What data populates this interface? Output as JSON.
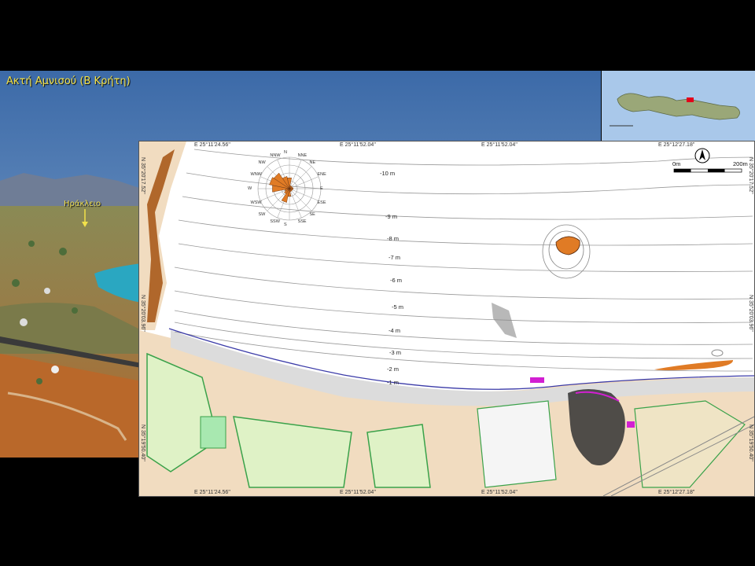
{
  "photo": {
    "title": "Ακτή Αμνισού (Β Κρήτη)",
    "city_label": "Ηράκλειο"
  },
  "map": {
    "coords_top": [
      "E 25°11'24.56\"",
      "E 25°11'52.04\"",
      "E 25°11'52.04\"",
      "E 25°12'27.18\""
    ],
    "coords_bottom": [
      "E 25°11'24.56\"",
      "E 25°11'52.04\"",
      "E 25°11'52.04\"",
      "E 25°12'27.18\""
    ],
    "coords_left": [
      "N 35°20'17.52\"",
      "N 35°20'03.96\"",
      "N 35°19'50.40\""
    ],
    "coords_right": [
      "N 35°20'17.52\"",
      "N 35°20'03.96\"",
      "N 35°19'50.40\""
    ],
    "depths": [
      "-10 m",
      "-9 m",
      "-8 m",
      "-7 m",
      "-6 m",
      "-5 m",
      "-4 m",
      "-3 m",
      "-2 m",
      "-1 m"
    ],
    "scale": {
      "start": "0m",
      "end": "200m"
    },
    "north_icon": "north-arrow-icon",
    "wind_rose": {
      "directions": [
        "N",
        "NNE",
        "NE",
        "ENE",
        "E",
        "ESE",
        "SE",
        "SSE",
        "S",
        "SSW",
        "SW",
        "WSW",
        "W",
        "WNW",
        "NW",
        "NNW"
      ],
      "petal_fractions": [
        0.35,
        0.1,
        0.1,
        0.1,
        0.12,
        0.1,
        0.1,
        0.1,
        0.25,
        0.45,
        0.2,
        0.15,
        0.55,
        0.65,
        0.6,
        0.4
      ],
      "petal_color": "#e07b25"
    },
    "colors": {
      "sea": "#ffffff",
      "beach": "#dcdcdc",
      "land_tan": "#f1dcc0",
      "vegetation": "#dff2c6",
      "green_line": "#3aa24a",
      "rock": "#e07b25",
      "shoreline": "#3b3ba8",
      "archaeology": "#d21fd2"
    }
  },
  "inset": {
    "marker_color": "#e3001b"
  }
}
